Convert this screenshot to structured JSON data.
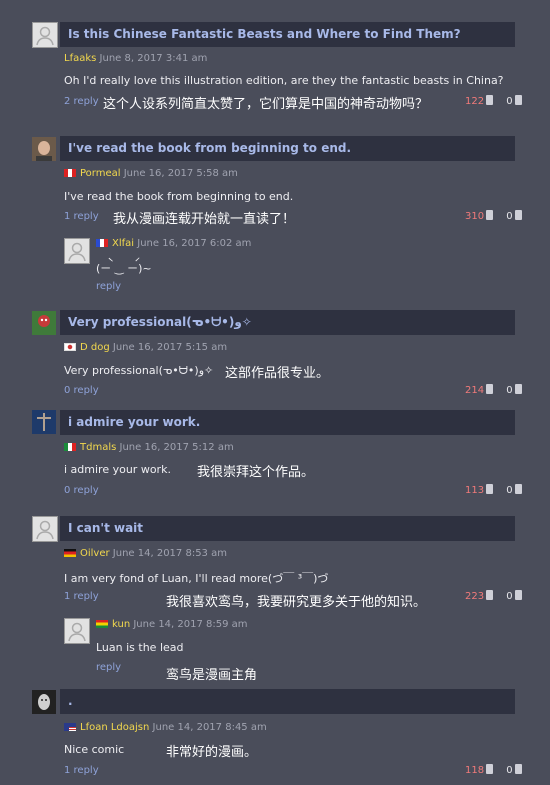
{
  "comments": [
    {
      "title": "Is this Chinese Fantastic Beasts and Where to Find Them?",
      "user": "Lfaaks",
      "date": "June 8, 2017 3:41 am",
      "body": "Oh I'd really love this illustration edition, are they the fantastic beasts in China?",
      "translation": "这个人设系列简直太赞了，它们算是中国的神奇动物吗？",
      "reply_label": "2 reply",
      "upvotes": "122",
      "downvotes": "0"
    },
    {
      "title": "I've read the book from beginning to end.",
      "user": "Pormeal",
      "date": "June 16, 2017 5:58 am",
      "body": "I've read the book from beginning to end.",
      "translation": "我从漫画连载开始就一直读了！",
      "reply_label": "1 reply",
      "upvotes": "310",
      "downvotes": "0",
      "flag": "peru",
      "sub": {
        "user": "Xlfai",
        "date": "June 16, 2017 6:02 am",
        "body": "(ㄧ̀ ‿ ㄧ́)~",
        "reply_label": "reply",
        "flag": "france"
      }
    },
    {
      "title": "Very professional(ᓀ•ᗨ•)و✧",
      "user": "D dog",
      "date": "June 16, 2017 5:15 am",
      "body": "Very professional(ᓀ•ᗨ•)و✧",
      "translation": "这部作品很专业。",
      "reply_label": "0 reply",
      "upvotes": "214",
      "downvotes": "0",
      "flag": "korea"
    },
    {
      "title": "i admire your work.",
      "user": "Tdmals",
      "date": "June 16, 2017 5:12 am",
      "body": "i admire your work.",
      "translation": "我很崇拜这个作品。",
      "reply_label": "0 reply",
      "upvotes": "113",
      "downvotes": "0",
      "flag": "mexico"
    },
    {
      "title": "I can't wait",
      "user": "Oilver",
      "date": "June 14, 2017 8:53 am",
      "body": "I am very fond of Luan, I'll read more(づ￣ ³￣)づ",
      "translation": "我很喜欢鸾鸟，我要研究更多关于他的知识。",
      "reply_label": "1 reply",
      "upvotes": "223",
      "downvotes": "0",
      "flag": "germany",
      "sub": {
        "user": "kun",
        "date": "June 14, 2017 8:59 am",
        "body": "Luan is the lead",
        "translation": "鸾鸟是漫画主角",
        "reply_label": "reply",
        "flag": "bolivia"
      }
    },
    {
      "title": ".",
      "user": "Lfoan Ldoajsn",
      "date": "June 14, 2017 8:45 am",
      "body": "Nice comic",
      "translation": "非常好的漫画。",
      "reply_label": "1 reply",
      "upvotes": "118",
      "downvotes": "0",
      "flag": "usa"
    }
  ]
}
